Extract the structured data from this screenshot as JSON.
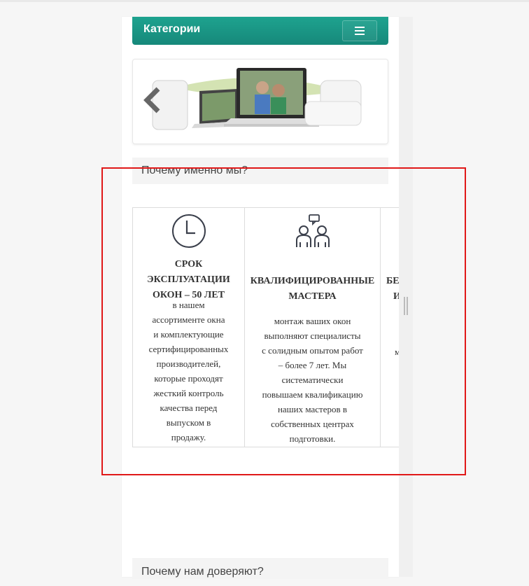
{
  "header": {
    "categories_label": "Категории",
    "menu_icon": "hamburger-icon"
  },
  "banner": {
    "prev_icon": "chevron-left-icon",
    "image_desc_icon": "laptop-devices-image"
  },
  "why_us": {
    "heading": "Почему именно мы?",
    "features": [
      {
        "icon": "clock-icon",
        "title_lines": [
          "СРОК",
          "ЭКСПЛУАТАЦИИ",
          "ОКОН – 50 ЛЕТ"
        ],
        "text_lines": [
          "в нашем",
          "ассортименте окна",
          "и комплектующие",
          "сертифицированных",
          "производителей,",
          "которые проходят",
          "жесткий контроль",
          "качества перед",
          "выпуском в",
          "продажу."
        ]
      },
      {
        "icon": "people-chat-icon",
        "title_lines": [
          "КВАЛИФИЦИРОВАННЫЕ",
          "МАСТЕРА"
        ],
        "text_lines": [
          "монтаж ваших окон",
          "выполняют  специалисты",
          "с солидным опытом работ",
          "– более 7 лет. Мы",
          "систематически",
          "повышаем квалификацию",
          "наших мастеров в",
          "собственных центрах",
          "подготовки."
        ]
      },
      {
        "icon": "partial-icon",
        "title_lines": [
          "БЕ",
          "И"
        ],
        "text_lines": [
          "м"
        ]
      }
    ]
  },
  "trust": {
    "heading": "Почему нам доверяют?"
  },
  "colors": {
    "accent": "#1a9a88",
    "highlight_box": "#e01818"
  }
}
